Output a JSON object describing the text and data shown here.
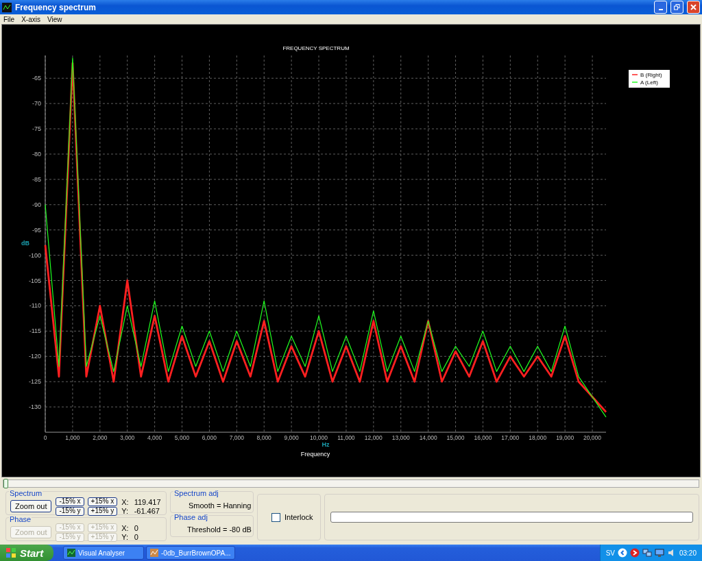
{
  "window": {
    "title": "Frequency spectrum"
  },
  "menu": [
    {
      "label": "File"
    },
    {
      "label": "X-axis"
    },
    {
      "label": "View"
    }
  ],
  "chart": {
    "caption": "Frequency",
    "chart_data": {
      "type": "line",
      "title": "FREQUENCY SPECTRUM",
      "xlabel": "Hz",
      "ylabel": "dB",
      "x": [
        0,
        500,
        1000,
        1500,
        2000,
        2500,
        3000,
        3500,
        4000,
        4500,
        5000,
        5500,
        6000,
        6500,
        7000,
        7500,
        8000,
        8500,
        9000,
        9500,
        10000,
        10500,
        11000,
        11500,
        12000,
        12500,
        13000,
        13500,
        14000,
        14500,
        15000,
        15500,
        16000,
        16500,
        17000,
        17500,
        18000,
        18500,
        19000,
        19500,
        20000,
        20500
      ],
      "series": [
        {
          "name": "B (Right)",
          "color": "#ff2020",
          "values": [
            -98,
            -124,
            -62,
            -124,
            -110,
            -125,
            -105,
            -124,
            -112,
            -125,
            -116,
            -124,
            -117,
            -125,
            -117,
            -124,
            -113,
            -125,
            -118,
            -124,
            -115,
            -125,
            -118,
            -125,
            -113,
            -125,
            -118,
            -125,
            -113,
            -125,
            -119,
            -124,
            -117,
            -125,
            -120,
            -124,
            -120,
            -124,
            -116,
            -125,
            -128,
            -131
          ]
        },
        {
          "name": "A (Left)",
          "color": "#20ff20",
          "values": [
            -90,
            -122,
            -61,
            -122,
            -112,
            -123,
            -110,
            -122,
            -109,
            -123,
            -114,
            -122,
            -115,
            -123,
            -115,
            -122,
            -109,
            -123,
            -116,
            -122,
            -112,
            -123,
            -116,
            -123,
            -111,
            -123,
            -116,
            -123,
            -113,
            -123,
            -118,
            -122,
            -115,
            -123,
            -118,
            -123,
            -118,
            -123,
            -114,
            -124,
            -128,
            -132
          ]
        }
      ],
      "xlim": [
        0,
        20500
      ],
      "ylim": [
        -135,
        -60.5
      ],
      "grid": true,
      "legend": true,
      "xticks": [
        {
          "value": 0,
          "label": "0"
        },
        {
          "value": 1000,
          "label": "1,000"
        },
        {
          "value": 2000,
          "label": "2,000"
        },
        {
          "value": 3000,
          "label": "3,000"
        },
        {
          "value": 4000,
          "label": "4,000"
        },
        {
          "value": 5000,
          "label": "5,000"
        },
        {
          "value": 6000,
          "label": "6,000"
        },
        {
          "value": 7000,
          "label": "7,000"
        },
        {
          "value": 8000,
          "label": "8,000"
        },
        {
          "value": 9000,
          "label": "9,000"
        },
        {
          "value": 10000,
          "label": "10,000"
        },
        {
          "value": 11000,
          "label": "11,000"
        },
        {
          "value": 12000,
          "label": "12,000"
        },
        {
          "value": 13000,
          "label": "13,000"
        },
        {
          "value": 14000,
          "label": "14,000"
        },
        {
          "value": 15000,
          "label": "15,000"
        },
        {
          "value": 16000,
          "label": "16,000"
        },
        {
          "value": 17000,
          "label": "17,000"
        },
        {
          "value": 18000,
          "label": "18,000"
        },
        {
          "value": 19000,
          "label": "19,000"
        },
        {
          "value": 20000,
          "label": "20,000"
        }
      ],
      "yticks": [
        -65,
        -70,
        -75,
        -80,
        -85,
        -90,
        -95,
        -100,
        -105,
        -110,
        -115,
        -120,
        -125,
        -130
      ]
    }
  },
  "position_slider": {
    "level": 0
  },
  "spectrum": {
    "title": "Spectrum",
    "zoom_button": {
      "label": "Zoom out",
      "disabled": false
    },
    "buttons": [
      {
        "label": "-15% x",
        "disabled": false
      },
      {
        "label": "+15% x",
        "disabled": false
      },
      {
        "label": "-15% y",
        "disabled": false
      },
      {
        "label": "+15% y",
        "disabled": false
      }
    ],
    "x_label": "X:",
    "x_value": "119.417",
    "y_label": "Y:",
    "y_value": "-61.467"
  },
  "phase": {
    "title": "Phase",
    "zoom_button": {
      "label": "Zoom out",
      "disabled": true
    },
    "buttons": [
      {
        "label": "-15% x",
        "disabled": true
      },
      {
        "label": "+15% x",
        "disabled": true
      },
      {
        "label": "-15% y",
        "disabled": true
      },
      {
        "label": "+15% y",
        "disabled": true
      }
    ],
    "x_label": "X:",
    "x_value": "0",
    "y_label": "Y:",
    "y_value": "0"
  },
  "spectrum_adj": {
    "title": "Spectrum adj",
    "text": "Smooth = Hanning"
  },
  "phase_adj": {
    "title": "Phase adj",
    "text": "Threshold = -80 dB"
  },
  "interlock": {
    "label": "Interlock",
    "checked": false
  },
  "taskbar": {
    "start": "Start",
    "tasks": [
      {
        "label": "Visual Analyser",
        "selected": false
      },
      {
        "label": "-0db_BurrBrownOPA...",
        "selected": false
      }
    ],
    "language": "SV",
    "time": "03:20"
  }
}
